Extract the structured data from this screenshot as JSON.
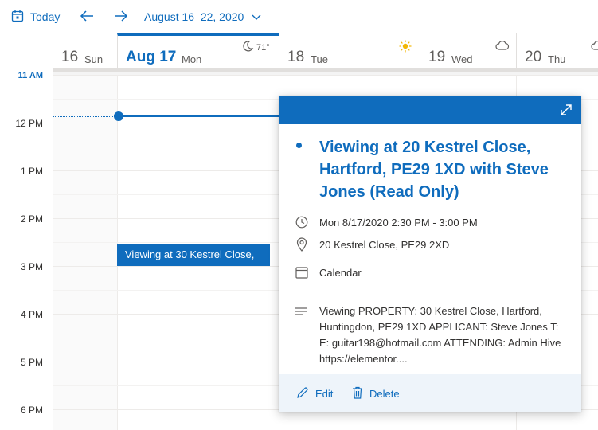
{
  "toolbar": {
    "today_label": "Today",
    "date_range": "August 16–22, 2020"
  },
  "days": [
    {
      "num": "16",
      "name": "Sun",
      "today": false,
      "weather_icon": "",
      "weather_temp": ""
    },
    {
      "num": "Aug 17",
      "name": "Mon",
      "today": true,
      "weather_icon": "moon-icon",
      "weather_temp": "71°"
    },
    {
      "num": "18",
      "name": "Tue",
      "today": false,
      "weather_icon": "sun-icon",
      "weather_temp": ""
    },
    {
      "num": "19",
      "name": "Wed",
      "today": false,
      "weather_icon": "cloud-icon",
      "weather_temp": ""
    },
    {
      "num": "20",
      "name": "Thu",
      "today": false,
      "weather_icon": "cloud-icon",
      "weather_temp": ""
    }
  ],
  "hours": [
    "11 AM",
    "12 PM",
    "1 PM",
    "2 PM",
    "3 PM",
    "4 PM",
    "5 PM",
    "6 PM"
  ],
  "event": {
    "block_label": "Viewing at 30 Kestrel Close,",
    "title": "Viewing at 20 Kestrel Close, Hartford, PE29 1XD with Steve Jones (Read Only)",
    "time": "Mon 8/17/2020 2:30 PM - 3:00 PM",
    "location": "20 Kestrel Close, PE29 2XD",
    "calendar": "Calendar",
    "description": "Viewing PROPERTY: 30 Kestrel Close, Hartford, Huntingdon, PE29 1XD APPLICANT: Steve Jones T: E: guitar198@hotmail.com ATTENDING: Admin Hive https://elementor....",
    "edit_label": "Edit",
    "delete_label": "Delete"
  },
  "colors": {
    "accent": "#0f6cbd",
    "footer_bg": "#eef4fa"
  }
}
